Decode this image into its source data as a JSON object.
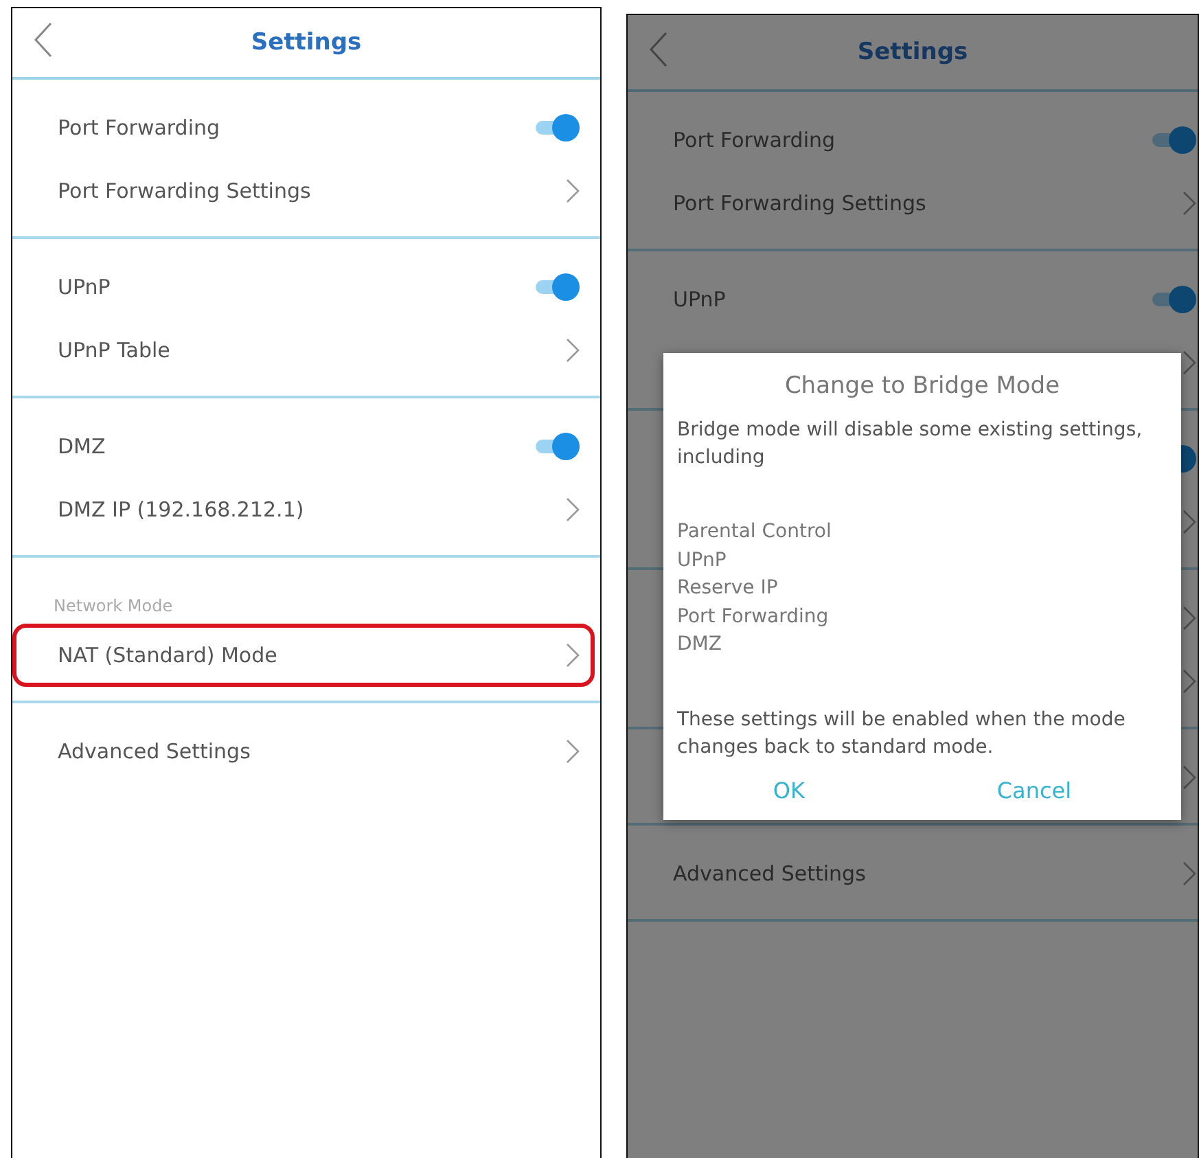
{
  "screens": [
    {
      "title": "Settings",
      "sections": [
        {
          "rows": [
            {
              "kind": "toggle",
              "label": "Port Forwarding",
              "on": true
            },
            {
              "kind": "link",
              "label": "Port Forwarding Settings"
            }
          ]
        },
        {
          "rows": [
            {
              "kind": "toggle",
              "label": "UPnP",
              "on": true
            },
            {
              "kind": "link",
              "label": "UPnP Table"
            }
          ]
        },
        {
          "rows": [
            {
              "kind": "toggle",
              "label": "DMZ",
              "on": true
            },
            {
              "kind": "link",
              "label": "DMZ IP (192.168.212.1)"
            }
          ]
        },
        {
          "heading": "Network Mode",
          "rows": [
            {
              "kind": "link",
              "label": "NAT (Standard) Mode",
              "highlighted": true
            }
          ]
        },
        {
          "rows": [
            {
              "kind": "link",
              "label": "Advanced Settings"
            }
          ]
        }
      ]
    },
    {
      "title": "Settings",
      "sections": [
        {
          "rows": [
            {
              "kind": "toggle",
              "label": "Port Forwarding",
              "on": true
            },
            {
              "kind": "link",
              "label": "Port Forwarding Settings"
            }
          ]
        },
        {
          "rows": [
            {
              "kind": "toggle",
              "label": "UPnP",
              "on": true
            },
            {
              "kind": "link"
            }
          ]
        },
        {
          "rows": [
            {
              "kind": "toggle",
              "on": true
            },
            {
              "kind": "link"
            }
          ]
        },
        {
          "rows": [
            {
              "kind": "link"
            },
            {
              "kind": "link"
            }
          ]
        },
        {
          "rows": [
            {
              "kind": "link"
            }
          ]
        },
        {
          "rows": [
            {
              "kind": "link",
              "label": "Advanced Settings"
            }
          ]
        }
      ],
      "dialog": {
        "title": "Change to Bridge Mode",
        "message": "Bridge mode will disable some existing settings, including",
        "items": [
          "Parental Control",
          "UPnP",
          "Reserve IP",
          "Port Forwarding",
          "DMZ"
        ],
        "footer": "These settings will be enabled when the mode changes back to standard mode.",
        "buttons": [
          "OK",
          "Cancel"
        ]
      }
    }
  ]
}
